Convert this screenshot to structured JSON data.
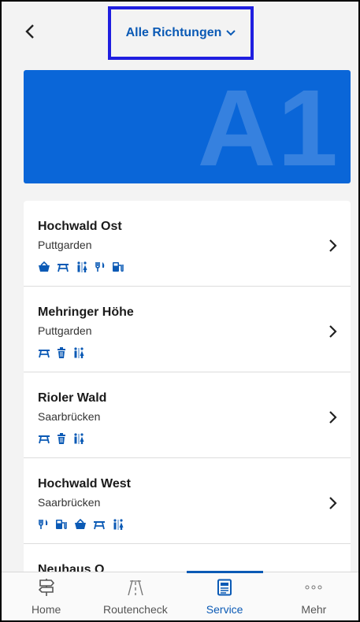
{
  "header": {
    "back_icon": "chevron-left-icon",
    "direction_label": "Alle Richtungen",
    "direction_icon": "chevron-down-icon"
  },
  "banner": {
    "road": "A1",
    "color": "#0a66d8"
  },
  "rest_areas": [
    {
      "name": "Hochwald Ost",
      "city": "Puttgarden",
      "icons": [
        "kiosk-icon",
        "picnic-icon",
        "wc-icon",
        "restaurant-icon",
        "fuel-icon"
      ]
    },
    {
      "name": "Mehringer Höhe",
      "city": "Puttgarden",
      "icons": [
        "picnic-icon",
        "trash-icon",
        "wc-icon"
      ]
    },
    {
      "name": "Rioler Wald",
      "city": "Saarbrücken",
      "icons": [
        "picnic-icon",
        "trash-icon",
        "wc-icon"
      ]
    },
    {
      "name": "Hochwald West",
      "city": "Saarbrücken",
      "icons": [
        "restaurant-icon",
        "fuel-icon",
        "kiosk-icon",
        "picnic-icon",
        "wc-icon"
      ]
    },
    {
      "name": "Neuhaus O",
      "city": "",
      "icons": []
    }
  ],
  "tabs": [
    {
      "label": "Home",
      "icon": "signpost-icon",
      "active": false
    },
    {
      "label": "Routencheck",
      "icon": "road-icon",
      "active": false
    },
    {
      "label": "Service",
      "icon": "news-icon",
      "active": true
    },
    {
      "label": "Mehr",
      "icon": "more-icon",
      "active": false
    }
  ],
  "colors": {
    "accent": "#0b5ab5",
    "highlight_border": "#1f1ee0"
  }
}
